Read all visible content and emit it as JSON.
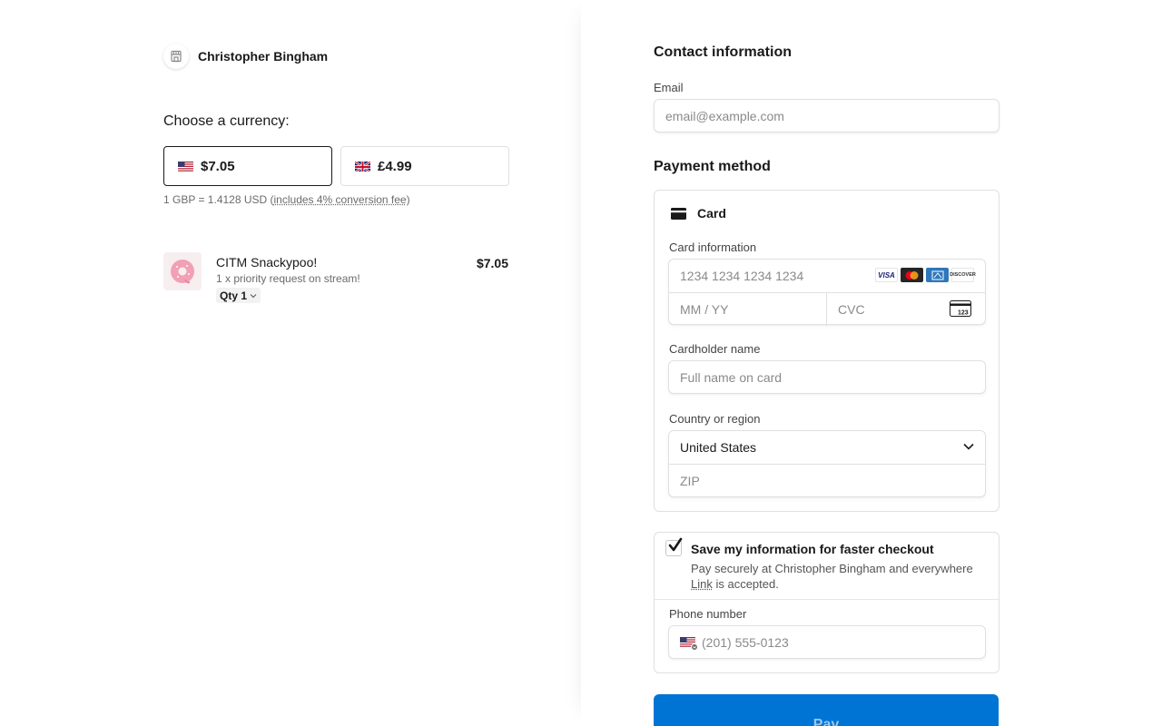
{
  "merchant": {
    "name": "Christopher Bingham",
    "icon": "storefront-icon"
  },
  "currency": {
    "title": "Choose a currency:",
    "options": [
      {
        "amount": "$7.05",
        "flag": "us-flag-icon",
        "selected": true
      },
      {
        "amount": "£4.99",
        "flag": "uk-flag-icon",
        "selected": false
      }
    ],
    "rate_prefix": "1 GBP = 1.4128 USD (",
    "rate_fee": "includes 4% conversion fee",
    "rate_suffix": ")"
  },
  "line_item": {
    "name": "CITM Snackypoo!",
    "description": "1 x priority request on stream!",
    "qty_label": "Qty 1",
    "price": "$7.05",
    "image": "donut-icon"
  },
  "contact": {
    "title": "Contact information",
    "email_label": "Email",
    "email_placeholder": "email@example.com"
  },
  "payment": {
    "title": "Payment method",
    "method_label": "Card",
    "card_info_label": "Card information",
    "card_number_placeholder": "1234 1234 1234 1234",
    "expiry_placeholder": "MM / YY",
    "cvc_placeholder": "CVC",
    "cvc_icon_text": "123",
    "brands": [
      {
        "name": "VISA",
        "bg": "#ffffff",
        "fg": "#1a1f71"
      },
      {
        "name": "mastercard",
        "bg": "#ffffff",
        "fg": "#eb001b"
      },
      {
        "name": "AMEX",
        "bg": "#2e77bc",
        "fg": "#ffffff"
      },
      {
        "name": "DISCOVER",
        "bg": "#ffffff",
        "fg": "#ee7623"
      }
    ],
    "cardholder_label": "Cardholder name",
    "cardholder_placeholder": "Full name on card",
    "country_label": "Country or region",
    "country_value": "United States",
    "zip_placeholder": "ZIP"
  },
  "save_info": {
    "checked": true,
    "title": "Save my information for faster checkout",
    "subtitle_prefix": "Pay securely at Christopher Bingham and everywhere ",
    "subtitle_link": "Link",
    "subtitle_suffix": " is accepted.",
    "phone_label": "Phone number",
    "phone_placeholder": "(201) 555-0123"
  },
  "pay_button": {
    "label": "Pay",
    "color": "#0074d4"
  }
}
